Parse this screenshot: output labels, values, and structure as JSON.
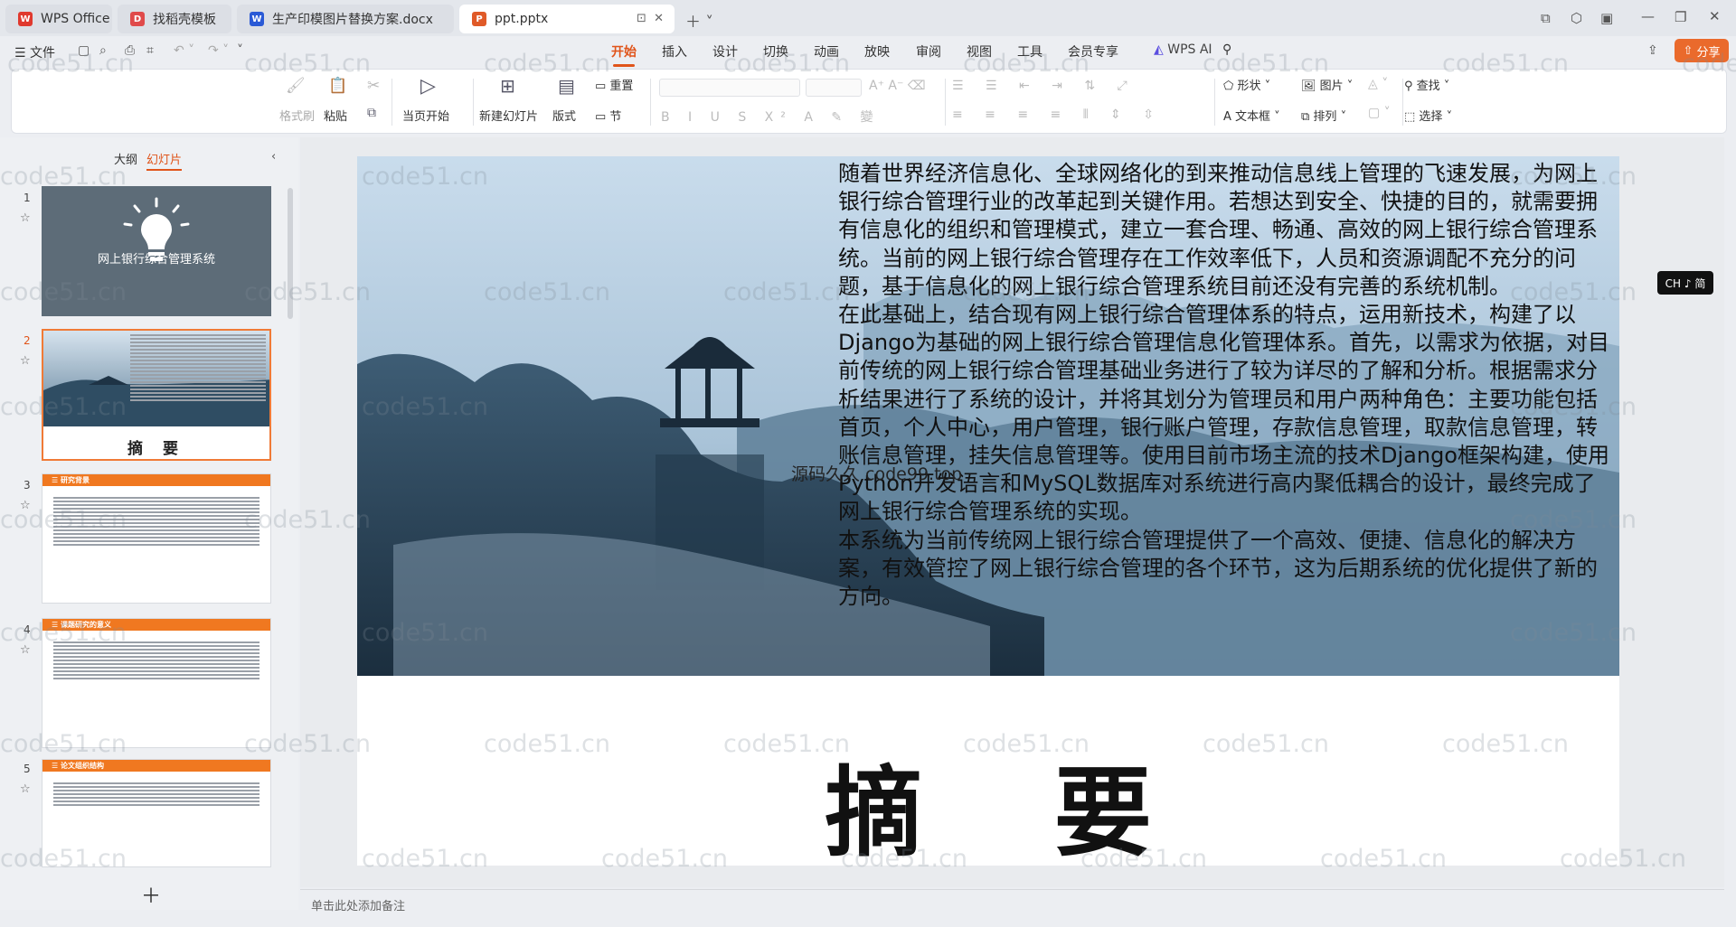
{
  "titlebar": {
    "tabs": [
      {
        "label": "WPS Office",
        "icon": "wps-logo-icon",
        "color": "#e0392e"
      },
      {
        "label": "找稻壳模板",
        "icon": "docer-icon",
        "color": "#e04a4a"
      },
      {
        "label": "生产印模图片替换方案.docx",
        "icon": "word-doc-icon",
        "color": "#2a5ad6"
      },
      {
        "label": "ppt.pptx",
        "icon": "ppt-doc-icon",
        "color": "#e05a28"
      }
    ]
  },
  "menubar": {
    "file": "文件",
    "tabs": [
      "开始",
      "插入",
      "设计",
      "切换",
      "动画",
      "放映",
      "审阅",
      "视图",
      "工具",
      "会员专享"
    ],
    "ai": "WPS AI",
    "share": "分享",
    "active": "开始"
  },
  "ribbon": {
    "format_brush": "格式刷",
    "paste": "粘贴",
    "start_from_current": "当页开始",
    "new_slide": "新建幻灯片",
    "layout": "版式",
    "reset": "重置",
    "section": "节",
    "shape": "形状",
    "picture": "图片",
    "textbox": "文本框",
    "arrange": "排列",
    "find": "查找",
    "select": "选择"
  },
  "left_panel": {
    "tab_outline": "大纲",
    "tab_slides": "幻灯片",
    "slide_numbers": [
      "1",
      "2",
      "3",
      "4",
      "5"
    ],
    "slide1_title": "网上银行综合管理系统",
    "slide2_title": "摘 要",
    "slide3_header": "研究背景",
    "slide4_header": "课题研究的意义",
    "slide5_header": "论文组织结构"
  },
  "slide": {
    "paragraphs": [
      "随着世界经济信息化、全球网络化的到来推动信息线上管理的飞速发展，为网上银行综合管理行业的改革起到关键作用。若想达到安全、快捷的目的，就需要拥有信息化的组织和管理模式，建立一套合理、畅通、高效的网上银行综合管理系统。当前的网上银行综合管理存在工作效率低下，人员和资源调配不充分的问题，基于信息化的网上银行综合管理系统目前还没有完善的系统机制。",
      "在此基础上，结合现有网上银行综合管理体系的特点，运用新技术，构建了以Django为基础的网上银行综合管理信息化管理体系。首先，以需求为依据，对目前传统的网上银行综合管理基础业务进行了较为详尽的了解和分析。根据需求分析结果进行了系统的设计，并将其划分为管理员和用户两种角色：主要功能包括首页，个人中心，用户管理，银行账户管理，存款信息管理，取款信息管理，转账信息管理，挂失信息管理等。使用目前市场主流的技术Django框架构建，使用Python开发语言和MySQL数据库对系统进行高内聚低耦合的设计，最终完成了网上银行综合管理系统的实现。",
      "本系统为当前传统网上银行综合管理提供了一个高效、便捷、信息化的解决方案，有效管控了网上银行综合管理的各个环节，这为后期系统的优化提供了新的方向。"
    ],
    "title": "摘 要",
    "overlay_text": "源码久久 code99.top"
  },
  "ime": "CH ♪ 简",
  "notes_placeholder": "单击此处添加备注",
  "watermark": "code51.cn"
}
